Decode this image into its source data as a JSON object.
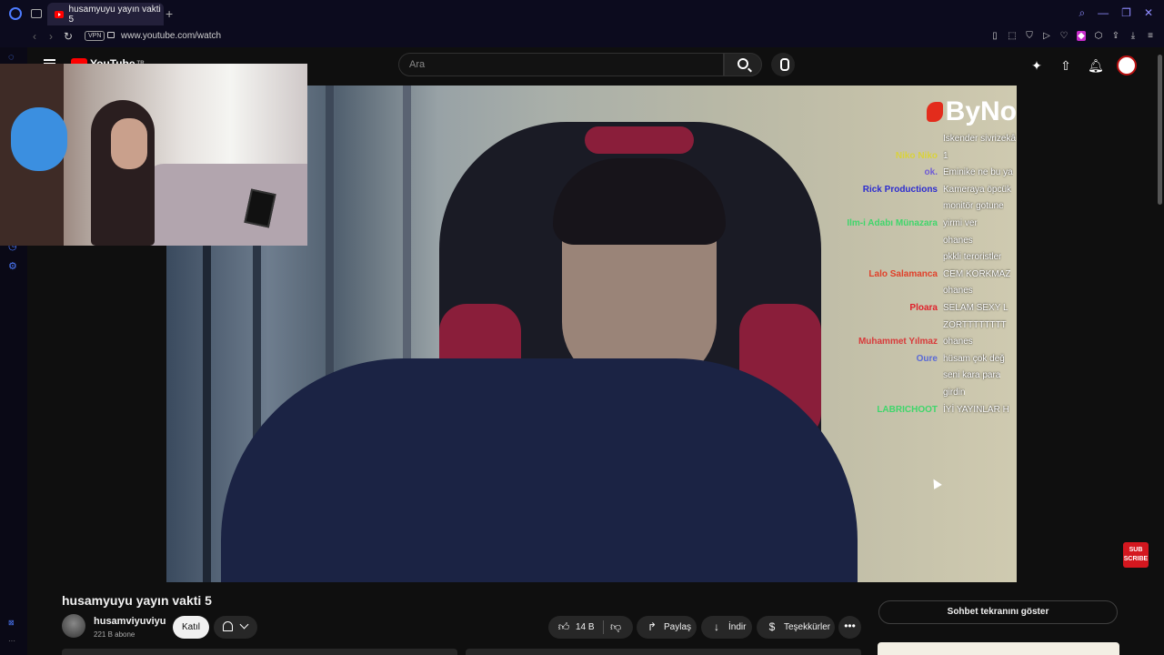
{
  "browser": {
    "tab_title": "husamyuyu yayın vakti 5",
    "new_tab": "+",
    "vpn_label": "VPN",
    "url": "www.youtube.com/watch",
    "window_controls": [
      "search-icon",
      "minimize-icon",
      "restore-icon",
      "close-icon"
    ]
  },
  "youtube": {
    "logo_text": "YouTube",
    "logo_region": "TR",
    "search_placeholder": "Ara"
  },
  "video": {
    "brand_text": "ByNo",
    "chat": [
      {
        "name": "",
        "message": "Iskender sivrizekâ",
        "color": "#e0567a"
      },
      {
        "name": "Niko Niko",
        "message": "1",
        "color": "#d9d23c"
      },
      {
        "name": "ok.",
        "message": "Eminike ne bu ya",
        "color": "#6f5bd6"
      },
      {
        "name": "Rick Productions",
        "message": "Kameraya öpcük",
        "color": "#2c2cd0"
      },
      {
        "name": "",
        "message": "monitör gotune",
        "color": "#e05a5a"
      },
      {
        "name": "Ilm-i Adabı Münazara",
        "message": "yirmi ver",
        "color": "#3fd66b"
      },
      {
        "name": "",
        "message": "ohanes",
        "color": "#e05aa0"
      },
      {
        "name": "",
        "message": "pkkli teroristler",
        "color": "#4fd1a0"
      },
      {
        "name": "Lalo Salamanca",
        "message": "CEM KORKMAZ",
        "color": "#e0402a"
      },
      {
        "name": "",
        "message": "ohanes",
        "color": "#e05aa0"
      },
      {
        "name": "Ploara",
        "message": "SELAM SEXY L",
        "color": "#e0202a"
      },
      {
        "name": "",
        "message": "ZORTTTTTTTT",
        "color": "#ffffff"
      },
      {
        "name": "Muhammet Yılmaz",
        "message": "ohanes",
        "color": "#d83a3a"
      },
      {
        "name": "Oure",
        "message": "hüsam çok değ",
        "color": "#5a6ad6"
      },
      {
        "name": "",
        "message": "seni kara para",
        "color": "#ffffff"
      },
      {
        "name": "",
        "message": "girdin",
        "color": "#ffffff"
      },
      {
        "name": "LABRICHOOT",
        "message": "İYİ YAYINLAR H",
        "color": "#3fd66b"
      }
    ],
    "subscribe_badge": "SUB SCRIBE"
  },
  "meta": {
    "title": "husamyuyu yayın vakti 5",
    "channel_name": "husamviyuviyu",
    "subscribers": "221 B abone",
    "join_label": "Katıl",
    "like_count": "14 B",
    "share_label": "Paylaş",
    "download_label": "İndir",
    "thanks_label": "Teşekkürler",
    "more_label": "•••",
    "show_chat_label": "Sohbet tekranını göster"
  }
}
